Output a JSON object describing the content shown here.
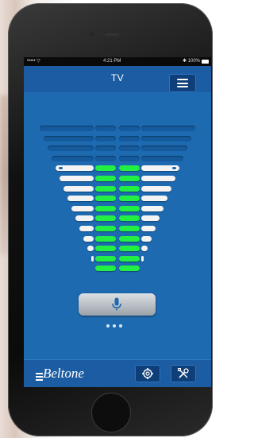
{
  "status_bar": {
    "left": "••••• ▽",
    "time": "4:21 PM",
    "right": "✱ 100%"
  },
  "header": {
    "title": "TV"
  },
  "equalizer": {
    "bands": 4,
    "active_rows": 11,
    "inactive_rows": 4,
    "colors": {
      "active": "#22ee44",
      "inactive": "#155a9c",
      "side_active": "#f4f4f4"
    }
  },
  "mic_button": {
    "icon": "microphone-icon"
  },
  "pager": {
    "pages": 3,
    "current": 1
  },
  "footer": {
    "brand": "Beltone",
    "settings_icon": "gear-icon",
    "tools_icon": "tools-icon"
  },
  "colors": {
    "screen_bg": "#1d6ab1",
    "header_bg": "#1c5ca2",
    "button_bg": "#0f3f78"
  }
}
